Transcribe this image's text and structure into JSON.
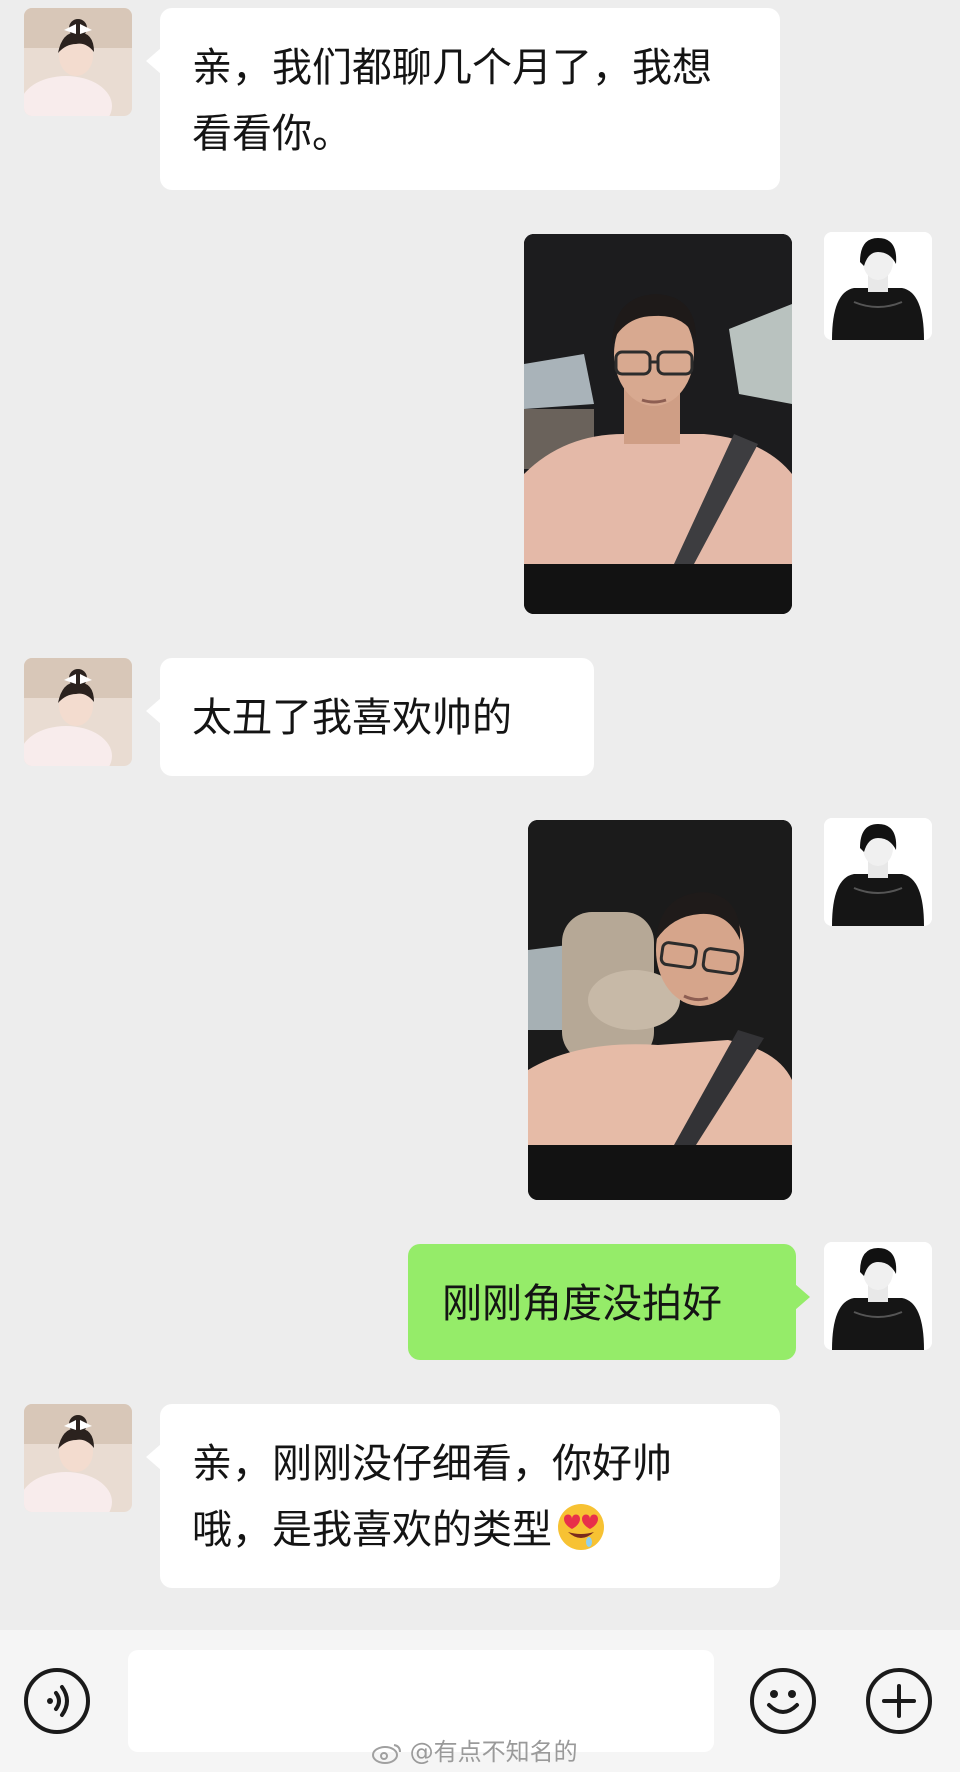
{
  "messages": [
    {
      "sender": "her",
      "type": "text",
      "text": "亲，我们都聊几个月了，我想看看你。"
    },
    {
      "sender": "me",
      "type": "photo",
      "description": "selfie-1"
    },
    {
      "sender": "her",
      "type": "text",
      "text": "太丑了我喜欢帅的"
    },
    {
      "sender": "me",
      "type": "photo",
      "description": "selfie-2"
    },
    {
      "sender": "me",
      "type": "text",
      "text": "刚刚角度没拍好"
    },
    {
      "sender": "her",
      "type": "text",
      "text": "亲，刚刚没仔细看，你好帅哦，是我喜欢的类型",
      "emoji": "heart-eyes"
    }
  ],
  "watermark": "@有点不知名的",
  "input_bar": {
    "voice_icon": "voice-icon",
    "emoji_icon": "emoji-icon",
    "plus_icon": "plus-icon",
    "text_value": ""
  },
  "colors": {
    "background": "#ededed",
    "bubble_incoming": "#ffffff",
    "bubble_outgoing": "#95ec69"
  }
}
